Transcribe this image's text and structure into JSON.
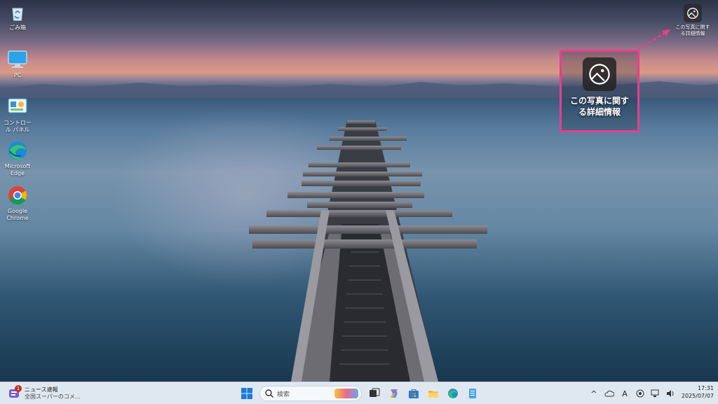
{
  "desktop_icons": [
    {
      "label": "ごみ箱",
      "icon": "recycle-bin-icon"
    },
    {
      "label": "PC",
      "icon": "pc-icon"
    },
    {
      "label": "コントロール パネル",
      "icon": "control-panel-icon"
    },
    {
      "label": "Microsoft Edge",
      "icon": "edge-icon"
    },
    {
      "label": "Google Chrome",
      "icon": "chrome-icon"
    }
  ],
  "spotlight": {
    "small_label": "この写真に関する詳細情報",
    "zoom_label_line1": "この写真に関す",
    "zoom_label_line2": "る詳細情報",
    "small_line1": "この写真に関す",
    "small_line2": "る詳細情報",
    "highlight_color": "#e83e8c"
  },
  "taskbar": {
    "news_title": "ニュース速報",
    "news_subtitle": "全国スーパーのコメ...",
    "news_badge": "1",
    "search_placeholder": "検索",
    "apps": [
      "start-icon",
      "search-icon",
      "task-view-icon",
      "copilot-icon",
      "store-icon",
      "file-explorer-icon",
      "edge-icon",
      "notepad-icon"
    ],
    "tray": {
      "chevron": "^",
      "ime": "A"
    },
    "time": "17:31",
    "date": "2025/07/07"
  }
}
